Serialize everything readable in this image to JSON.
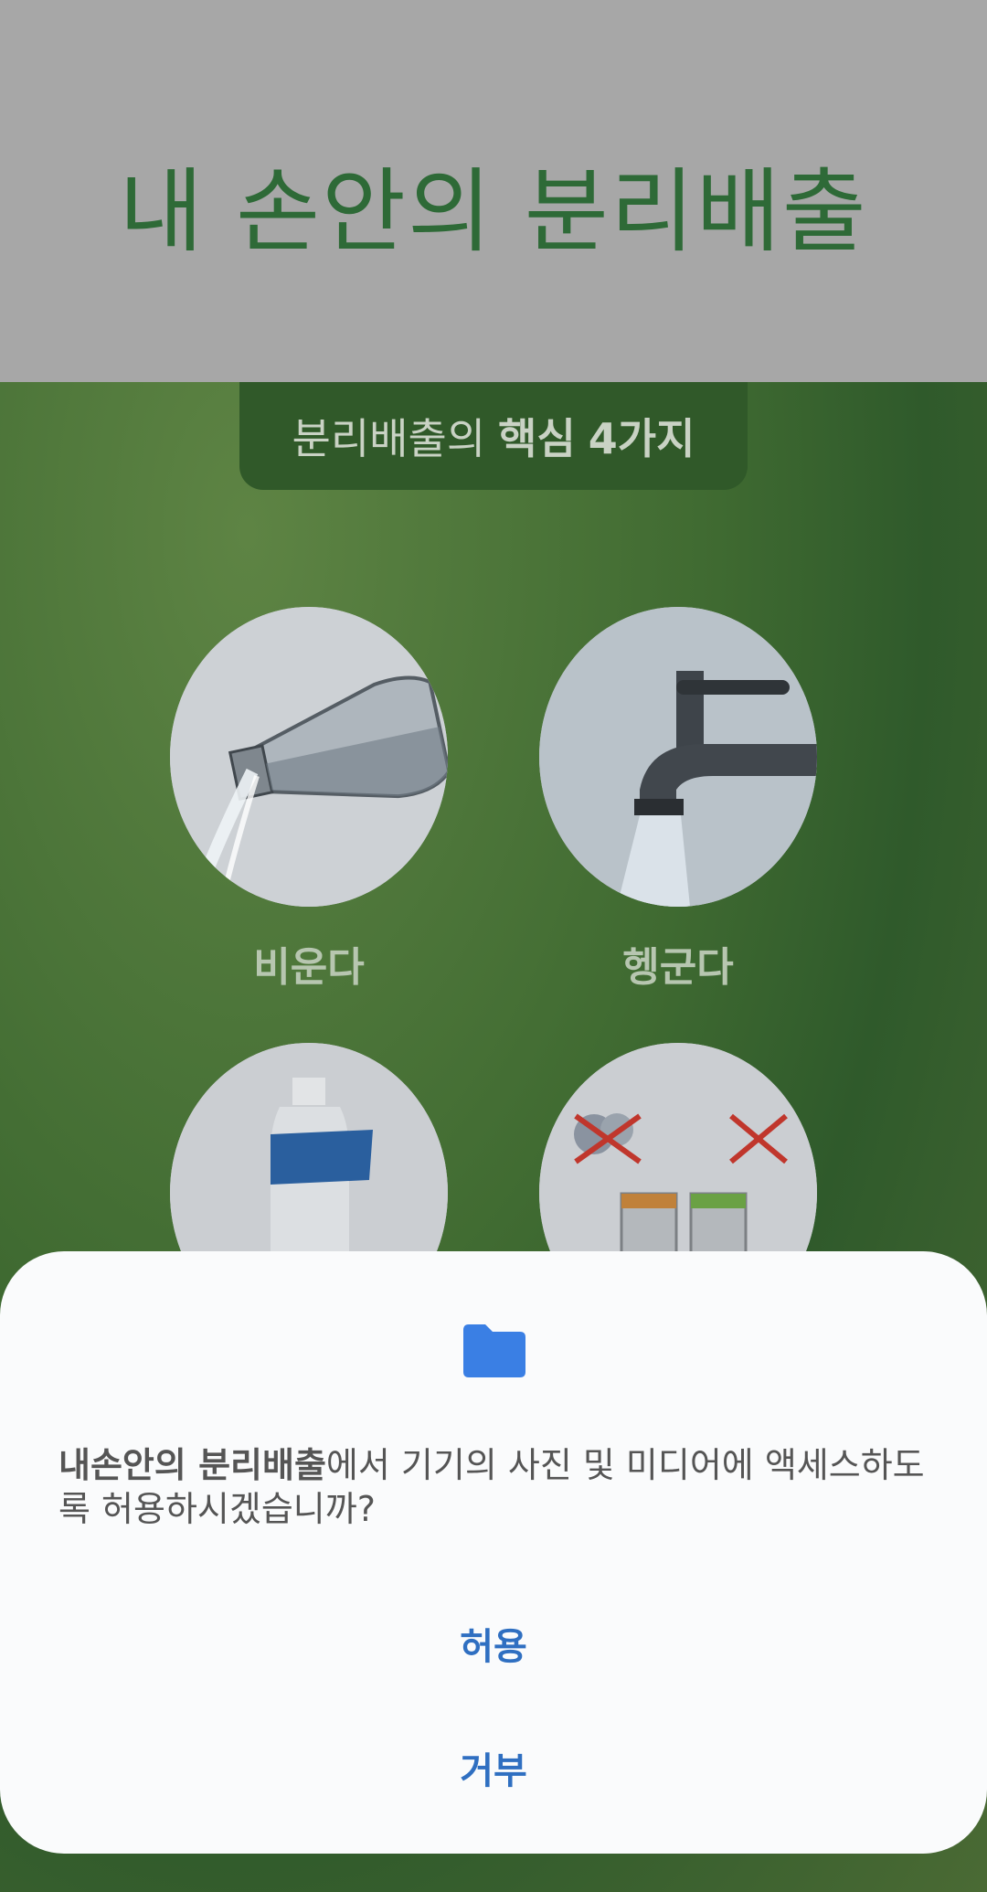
{
  "app": {
    "title": "내 손안의 분리배출"
  },
  "section_tab": {
    "prefix": "분리배출의",
    "bold1": "핵심",
    "bold2": "4가지"
  },
  "steps": [
    {
      "label": "비운다",
      "icon": "bottle-pour-icon"
    },
    {
      "label": "헹군다",
      "icon": "faucet-icon"
    },
    {
      "label": "",
      "icon": "bottle-label-icon"
    },
    {
      "label": "",
      "icon": "sorting-bins-icon"
    }
  ],
  "dialog": {
    "icon": "folder-icon",
    "app_name": "내손안의 분리배출",
    "message_rest": "에서 기기의 사진 및 미디어에 액세스하도록 허용하시겠습니까?",
    "allow_label": "허용",
    "deny_label": "거부",
    "accent_color": "#2f6fc1"
  }
}
